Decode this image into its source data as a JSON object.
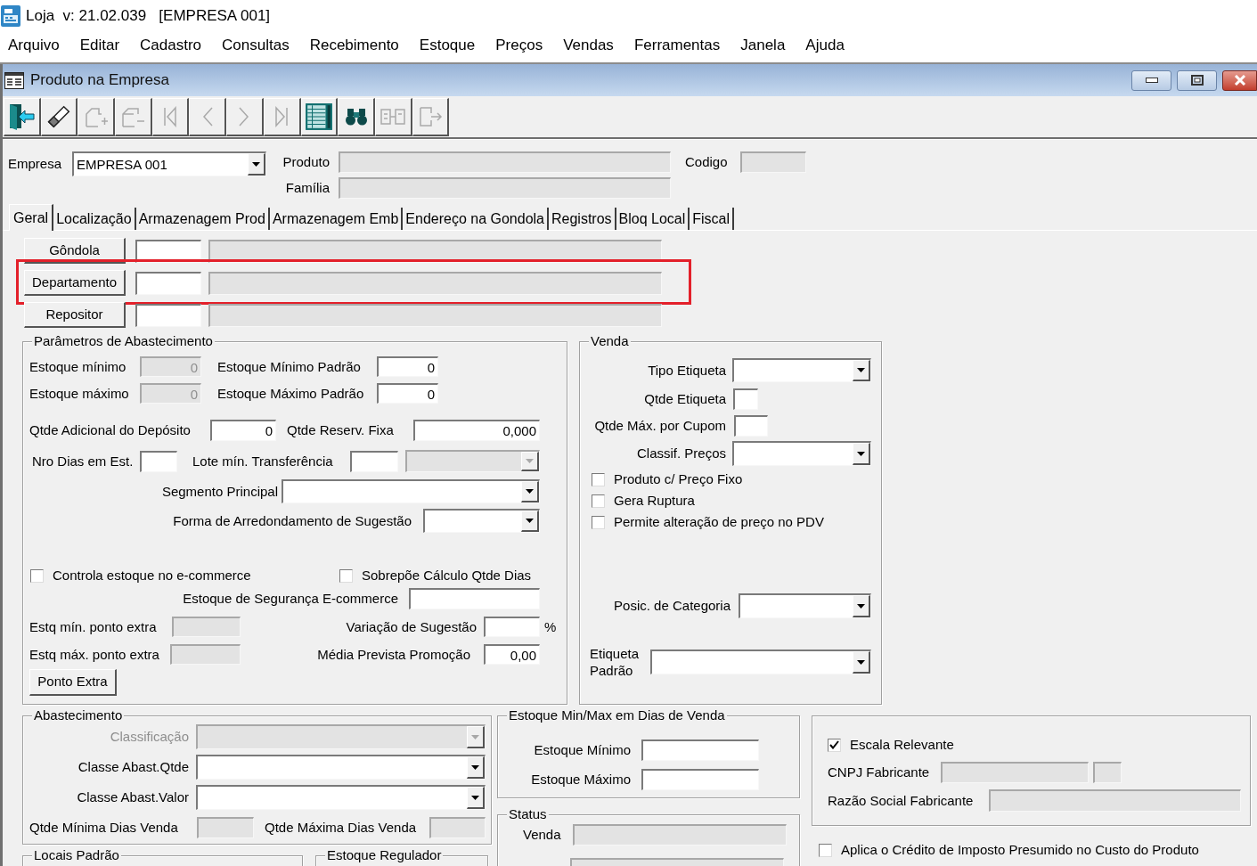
{
  "app": {
    "title": "Loja  v: 21.02.039   [EMPRESA 001]"
  },
  "menu": [
    "Arquivo",
    "Editar",
    "Cadastro",
    "Consultas",
    "Recebimento",
    "Estoque",
    "Preços",
    "Vendas",
    "Ferramentas",
    "Janela",
    "Ajuda"
  ],
  "window": {
    "title": "Produto na Empresa"
  },
  "toolbar": [
    {
      "kind": "exit",
      "disabled": false
    },
    {
      "kind": "clear",
      "disabled": false
    },
    {
      "kind": "insert",
      "disabled": true
    },
    {
      "kind": "delete",
      "disabled": true
    },
    {
      "kind": "first",
      "disabled": true
    },
    {
      "kind": "previous",
      "disabled": true
    },
    {
      "kind": "next",
      "disabled": true
    },
    {
      "kind": "last",
      "disabled": true
    },
    {
      "kind": "list",
      "disabled": false
    },
    {
      "kind": "search",
      "disabled": false
    },
    {
      "kind": "link",
      "disabled": true
    },
    {
      "kind": "export",
      "disabled": true
    }
  ],
  "header": {
    "empresa": {
      "label": "Empresa",
      "value": "EMPRESA 001",
      "disabled": false
    },
    "produto": {
      "label": "Produto",
      "disabled": true
    },
    "familia": {
      "label": "Família",
      "disabled": true
    },
    "codigo": {
      "label": "Codigo",
      "disabled": true
    }
  },
  "tabs": [
    {
      "label": "Geral",
      "selected": true
    },
    {
      "label": "Localização",
      "selected": false
    },
    {
      "label": "Armazenagem Prod",
      "selected": false
    },
    {
      "label": "Armazenagem Emb",
      "selected": false
    },
    {
      "label": "Endereço na Gondola",
      "selected": false
    },
    {
      "label": "Registros",
      "selected": false
    },
    {
      "label": "Bloq Local",
      "selected": false
    },
    {
      "label": "Fiscal",
      "selected": false
    }
  ],
  "lookups": [
    {
      "button": "Gôndola",
      "highlighted": false,
      "code": {
        "disabled": false
      },
      "description": {
        "disabled": true
      }
    },
    {
      "button": "Departamento",
      "highlighted": true,
      "code": {
        "disabled": false
      },
      "description": {
        "disabled": true
      }
    },
    {
      "button": "Repositor",
      "highlighted": false,
      "code": {
        "disabled": false
      },
      "description": {
        "disabled": true
      }
    }
  ],
  "parametros": {
    "title": "Parâmetros de Abastecimento",
    "estoque_minimo": {
      "label": "Estoque mínimo",
      "value": "0",
      "disabled": true
    },
    "estoque_minimo_padrao": {
      "label": "Estoque Mínimo Padrão",
      "value": "0",
      "disabled": false
    },
    "estoque_maximo": {
      "label": "Estoque máximo",
      "value": "0",
      "disabled": true
    },
    "estoque_maximo_padrao": {
      "label": "Estoque Máximo Padrão",
      "value": "0",
      "disabled": false
    },
    "qtde_adicional": {
      "label": "Qtde Adicional do Depósito",
      "value": "0",
      "disabled": false
    },
    "qtde_reserv": {
      "label": "Qtde Reserv. Fixa",
      "value": "0,000",
      "disabled": false
    },
    "nro_dias": {
      "label": "Nro Dias em Est.",
      "disabled": false
    },
    "lote_min": {
      "label": "Lote mín. Transferência",
      "disabled": false
    },
    "lote_combo": {
      "disabled": true
    },
    "segmento": {
      "label": "Segmento Principal",
      "disabled": false
    },
    "arredondamento": {
      "label": "Forma de Arredondamento de Sugestão",
      "disabled": false
    },
    "controla_ecommerce": {
      "label": "Controla estoque no e-commerce",
      "checked": false
    },
    "sobrepoe": {
      "label": "Sobrepõe Cálculo Qtde Dias",
      "checked": false
    },
    "seguranca_ecommerce": {
      "label": "Estoque de Segurança E-commerce",
      "disabled": false
    },
    "estq_min_extra": {
      "label": "Estq mín. ponto extra",
      "disabled": true
    },
    "variacao": {
      "label": "Variação de Sugestão",
      "unit": "%",
      "disabled": false
    },
    "estq_max_extra": {
      "label": "Estq máx. ponto extra",
      "disabled": true
    },
    "media_promocao": {
      "label": "Média Prevista Promoção",
      "value": "0,00",
      "disabled": false
    },
    "ponto_extra_button": "Ponto Extra"
  },
  "venda": {
    "title": "Venda",
    "tipo_etiqueta": {
      "label": "Tipo Etiqueta",
      "disabled": false
    },
    "qtde_etiqueta": {
      "label": "Qtde Etiqueta",
      "disabled": false
    },
    "qtde_max_cupom": {
      "label": "Qtde Máx. por Cupom",
      "disabled": false
    },
    "classif_precos": {
      "label": "Classif. Preços",
      "disabled": false
    },
    "checks": [
      {
        "label": "Produto c/ Preço Fixo",
        "checked": false
      },
      {
        "label": "Gera Ruptura",
        "checked": false
      },
      {
        "label": "Permite alteração de preço no PDV",
        "checked": false
      }
    ],
    "posic_categoria": {
      "label": "Posic. de Categoria",
      "disabled": false
    },
    "etiqueta_padrao": {
      "label": "Etiqueta Padrão",
      "disabled": false
    }
  },
  "abastecimento": {
    "title": "Abastecimento",
    "classificacao": {
      "label": "Classificação",
      "disabled": true
    },
    "classe_qtde": {
      "label": "Classe Abast.Qtde",
      "disabled": false
    },
    "classe_valor": {
      "label": "Classe Abast.Valor",
      "disabled": false
    },
    "qtde_min_dias": {
      "label": "Qtde Mínima Dias Venda",
      "disabled": true
    },
    "qtde_max_dias": {
      "label": "Qtde Máxima Dias Venda",
      "disabled": true
    }
  },
  "locais_padrao": {
    "title": "Locais Padrão"
  },
  "estoque_regulador": {
    "title": "Estoque Regulador"
  },
  "dias_venda": {
    "title": "Estoque Min/Max em Dias de Venda",
    "minimo": {
      "label": "Estoque Mínimo",
      "disabled": false
    },
    "maximo": {
      "label": "Estoque Máximo",
      "disabled": false
    }
  },
  "status": {
    "title": "Status",
    "fields": [
      {
        "label": "Venda",
        "disabled": true
      },
      {
        "disabled": true
      }
    ]
  },
  "fabricante": {
    "escala_relevante": {
      "label": "Escala Relevante",
      "checked": true
    },
    "cnpj": {
      "label": "CNPJ Fabricante",
      "disabled": true,
      "field_2": {
        "disabled": true
      }
    },
    "razao_social": {
      "label": "Razão Social Fabricante",
      "disabled": true
    }
  },
  "aplica_credito": {
    "label": "Aplica o Crédito de Imposto Presumido no Custo do Produto",
    "checked": false
  }
}
